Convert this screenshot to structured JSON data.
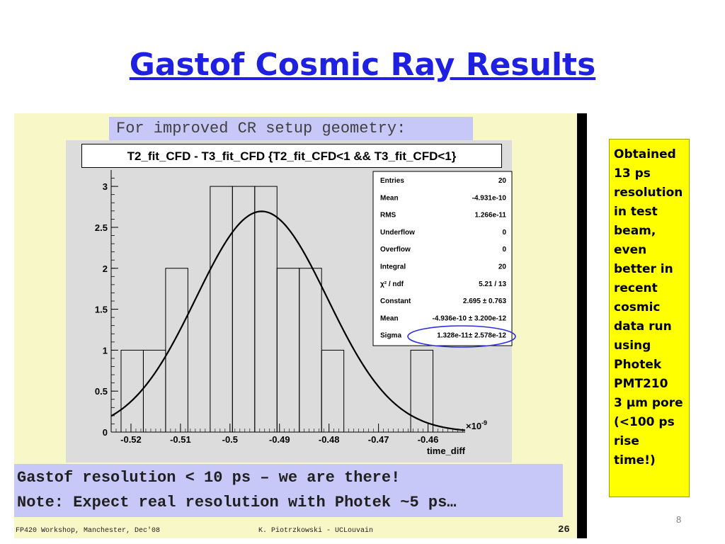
{
  "slide": {
    "title": "Gastof Cosmic Ray Results",
    "page_number": "8",
    "side_note": [
      "Obtained",
      "13 ps",
      "resolution",
      "in test",
      "beam,",
      "even",
      "better in",
      "recent",
      "cosmic",
      "data run",
      "using",
      "Photek",
      "PMT210",
      "3 μm pore",
      "(<100 ps",
      "rise time!)"
    ]
  },
  "embedded_slide": {
    "header": "For improved CR setup geometry:",
    "note_line1": "Gastof resolution < 10 ps – we are there!",
    "note_line2": "Note: Expect real resolution with Photek ~5 ps…",
    "footer_left": "FP420 Workshop, Manchester, Dec'08",
    "footer_center": "K. Piotrzkowski - UCLouvain",
    "footer_right": "26"
  },
  "colors": {
    "title": "#2020e0",
    "side_box": "#ffff00",
    "note_bg": "#c8c8f8",
    "slide_bg": "#f8f7c8",
    "sigma_ellipse": "#3030e0"
  },
  "chart_data": {
    "type": "bar",
    "title": "T2_fit_CFD - T3_fit_CFD {T2_fit_CFD<1 && T3_fit_CFD<1}",
    "xlabel": "time_diff",
    "x_multiplier": "×10",
    "x_multiplier_exp": "-9",
    "ylabel": "",
    "xlim": [
      -0.524,
      -0.4525
    ],
    "ylim": [
      0,
      3.2
    ],
    "x_ticks": [
      -0.52,
      -0.51,
      -0.5,
      -0.49,
      -0.48,
      -0.47,
      -0.46
    ],
    "x_tick_labels": [
      "-0.52",
      "-0.51",
      "-0.5",
      "-0.49",
      "-0.48",
      "-0.47",
      "-0.46"
    ],
    "y_ticks": [
      0,
      0.5,
      1,
      1.5,
      2,
      2.5,
      3
    ],
    "y_tick_labels": [
      "0",
      "0.5",
      "1",
      "1.5",
      "2",
      "2.5",
      "3"
    ],
    "bins": [
      {
        "x0": -0.522,
        "x1": -0.5175,
        "value": 1
      },
      {
        "x0": -0.5175,
        "x1": -0.513,
        "value": 1
      },
      {
        "x0": -0.513,
        "x1": -0.5085,
        "value": 2
      },
      {
        "x0": -0.5085,
        "x1": -0.504,
        "value": 0
      },
      {
        "x0": -0.504,
        "x1": -0.4995,
        "value": 3
      },
      {
        "x0": -0.4995,
        "x1": -0.495,
        "value": 3
      },
      {
        "x0": -0.495,
        "x1": -0.4905,
        "value": 3
      },
      {
        "x0": -0.4905,
        "x1": -0.486,
        "value": 2
      },
      {
        "x0": -0.486,
        "x1": -0.4815,
        "value": 2
      },
      {
        "x0": -0.4815,
        "x1": -0.477,
        "value": 1
      },
      {
        "x0": -0.477,
        "x1": -0.4725,
        "value": 0
      },
      {
        "x0": -0.4725,
        "x1": -0.468,
        "value": 0
      },
      {
        "x0": -0.468,
        "x1": -0.4635,
        "value": 0
      },
      {
        "x0": -0.4635,
        "x1": -0.459,
        "value": 1
      },
      {
        "x0": -0.459,
        "x1": -0.4545,
        "value": 0
      }
    ],
    "fit": {
      "constant": 2.695,
      "mean": -0.4936,
      "sigma": 0.01328
    },
    "stats": [
      {
        "label": "Entries",
        "value": "20"
      },
      {
        "label": "Mean",
        "value": "-4.931e-10"
      },
      {
        "label": "RMS",
        "value": "1.266e-11"
      },
      {
        "label": "Underflow",
        "value": "0"
      },
      {
        "label": "Overflow",
        "value": "0"
      },
      {
        "label": "Integral",
        "value": "20"
      },
      {
        "label": "χ² / ndf",
        "value": "5.21 / 13"
      },
      {
        "label": "Constant",
        "value": "2.695 ± 0.763"
      },
      {
        "label": "Mean",
        "value": "-4.936e-10 ± 3.200e-12"
      },
      {
        "label": "Sigma",
        "value": "1.328e-11± 2.578e-12"
      }
    ]
  }
}
